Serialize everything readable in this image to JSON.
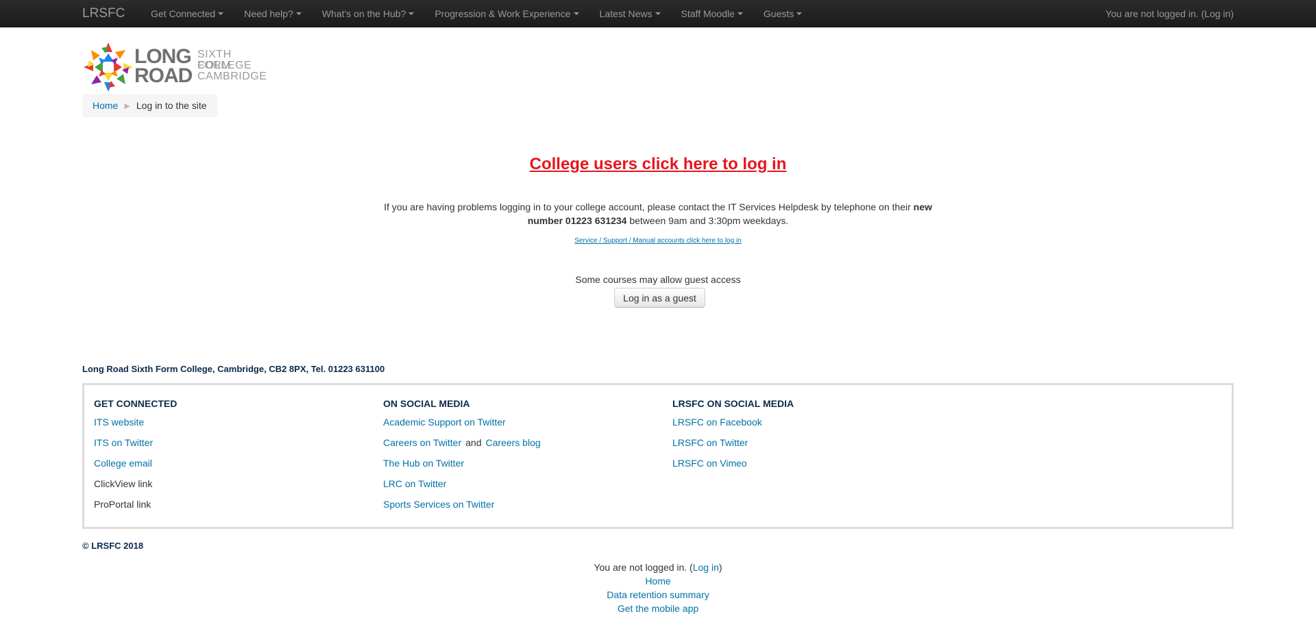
{
  "navbar": {
    "brand": "LRSFC",
    "items": [
      {
        "label": "Get Connected"
      },
      {
        "label": "Need help?"
      },
      {
        "label": "What's on the Hub?"
      },
      {
        "label": "Progression & Work Experience"
      },
      {
        "label": "Latest News"
      },
      {
        "label": "Staff Moodle"
      },
      {
        "label": "Guests"
      }
    ],
    "login_text": "You are not logged in. (",
    "login_link": "Log in",
    "login_close": ")"
  },
  "logo": {
    "line1": "LONG",
    "line2": "ROAD",
    "sub1": "SIXTH FORM",
    "sub2": "COLLEGE",
    "sub3": "CAMBRIDGE"
  },
  "breadcrumb": {
    "home": "Home",
    "separator": "▶",
    "current": "Log in to the site"
  },
  "main": {
    "college_login": "College users click here to log in",
    "help_part1": "If you are having problems logging in to your college account, please contact the IT Services Helpdesk by telephone on their ",
    "help_bold": "new number 01223 631234",
    "help_part2": " between 9am and 3:30pm weekdays.",
    "service_link": "Service / Support / Manual accounts click here to log in",
    "guest_text": "Some courses may allow guest access",
    "guest_button": "Log in as a guest"
  },
  "footer": {
    "address": "Long Road Sixth Form College, Cambridge, CB2 8PX, Tel. 01223 631100",
    "columns": [
      {
        "heading": "GET CONNECTED",
        "links": [
          "ITS website",
          "ITS on Twitter",
          "College email",
          "ClickView link",
          "ProPortal link"
        ]
      },
      {
        "heading": "ON SOCIAL MEDIA",
        "links": [
          "Academic Support on Twitter",
          "Careers on Twitter",
          "The Hub on Twitter",
          "LRC on Twitter",
          "Sports Services on Twitter"
        ],
        "and_text": "and",
        "careers_blog": "Careers blog"
      },
      {
        "heading": "LRSFC ON SOCIAL MEDIA",
        "links": [
          "LRSFC on Facebook",
          "LRSFC on Twitter",
          "LRSFC on Vimeo"
        ]
      }
    ],
    "copyright": "© LRSFC 2018",
    "not_logged": "You are not logged in. (",
    "login_link": "Log in",
    "login_close": ")",
    "home": "Home",
    "data_retention": "Data retention summary",
    "mobile_app": "Get the mobile app"
  },
  "colors": {
    "navbar_bg": "#1b1b1b",
    "link": "#0070a8",
    "college_login": "#e8141c",
    "footer_heading": "#0b2a4a"
  }
}
